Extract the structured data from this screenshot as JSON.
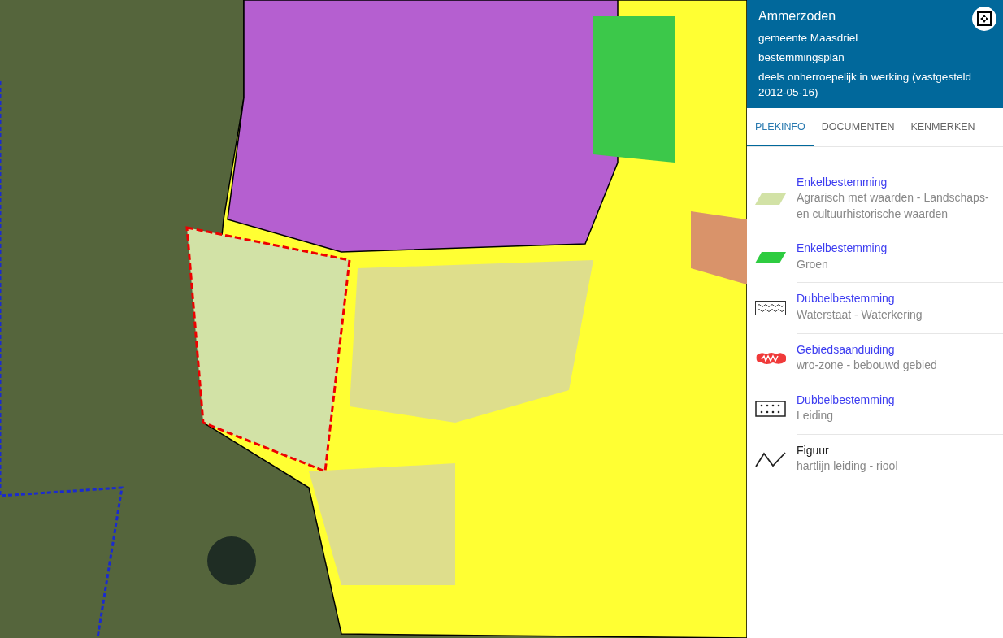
{
  "header": {
    "title": "Ammerzoden",
    "lines": [
      "gemeente Maasdriel",
      "bestemmingsplan",
      "deels onherroepelijk in werking (vastgesteld 2012-05-16)"
    ]
  },
  "tabs": [
    {
      "label": "PLEKINFO",
      "selected": true
    },
    {
      "label": "DOCUMENTEN",
      "selected": false
    },
    {
      "label": "KENMERKEN",
      "selected": false
    }
  ],
  "legend": [
    {
      "kind": "fill-light",
      "title": "Enkelbestemming",
      "linked": true,
      "description": "Agrarisch met waarden - Landschaps- en cultuurhistorische waarden"
    },
    {
      "kind": "fill-green",
      "title": "Enkelbestemming",
      "linked": true,
      "description": "Groen"
    },
    {
      "kind": "wave",
      "title": "Dubbelbestemming",
      "linked": true,
      "description": "Waterstaat - Waterkering"
    },
    {
      "kind": "zone",
      "title": "Gebiedsaanduiding",
      "linked": true,
      "description": "wro-zone - bebouwd gebied"
    },
    {
      "kind": "dots",
      "title": "Dubbelbestemming",
      "linked": true,
      "description": "Leiding"
    },
    {
      "kind": "zigzag",
      "title": "Figuur",
      "linked": false,
      "description": "hartlijn leiding - riool"
    }
  ]
}
